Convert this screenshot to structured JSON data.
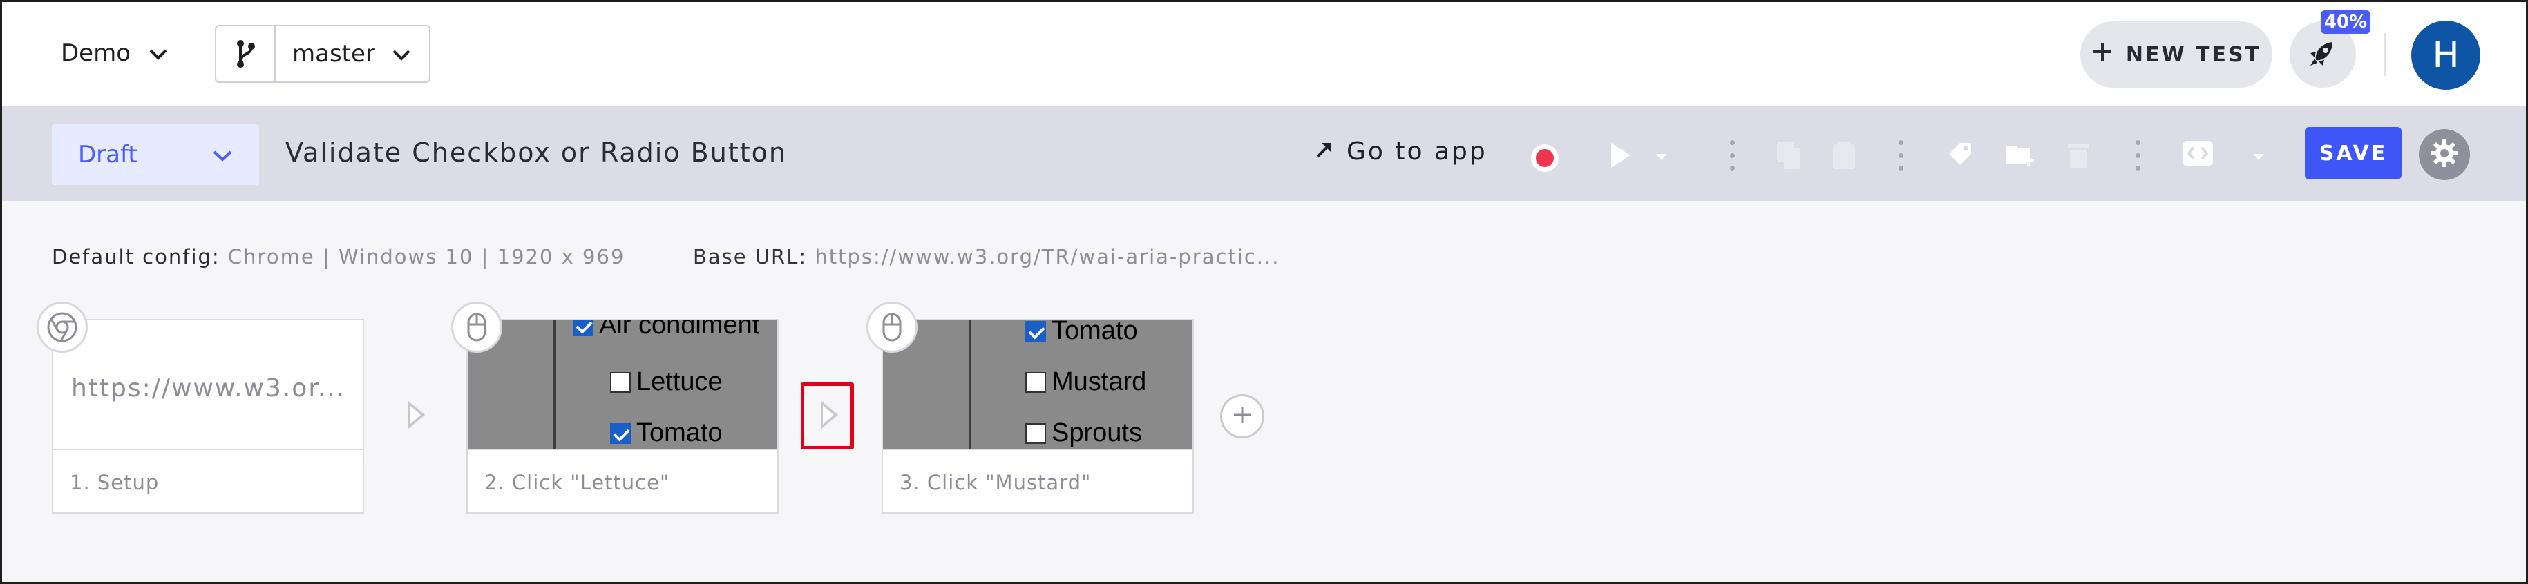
{
  "topbar": {
    "project": "Demo",
    "branch": "master",
    "new_test_label": "NEW TEST",
    "notification_badge": "40%",
    "avatar_initial": "H"
  },
  "testbar": {
    "status": "Draft",
    "title": "Validate Checkbox or Radio Button",
    "goto_label": "Go to app",
    "save_label": "SAVE"
  },
  "config": {
    "default_config_label": "Default config:",
    "default_config_value": "Chrome | Windows 10 | 1920 x 969",
    "base_url_label": "Base URL:",
    "base_url_value": "https://www.w3.org/TR/wai-aria-practic..."
  },
  "steps": [
    {
      "caption": "1. Setup",
      "url": "https://www.w3.or...",
      "icon": "chrome-icon"
    },
    {
      "caption": "2. Click \"Lettuce\"",
      "icon": "mouse-icon",
      "shot_rows": [
        {
          "label": "Air condiment",
          "checked": true
        },
        {
          "label": "Lettuce",
          "checked": false
        },
        {
          "label": "Tomato",
          "checked": true
        }
      ]
    },
    {
      "caption": "3. Click \"Mustard\"",
      "icon": "mouse-icon",
      "shot_rows": [
        {
          "label": "Tomato",
          "checked": true
        },
        {
          "label": "Mustard",
          "checked": false
        },
        {
          "label": "Sprouts",
          "checked": false
        }
      ]
    }
  ],
  "colors": {
    "accent": "#3d56f5",
    "draft_bg": "#e7ebff",
    "record": "#f0354f",
    "avatar": "#0e55a6",
    "highlight": "#e3001b"
  }
}
